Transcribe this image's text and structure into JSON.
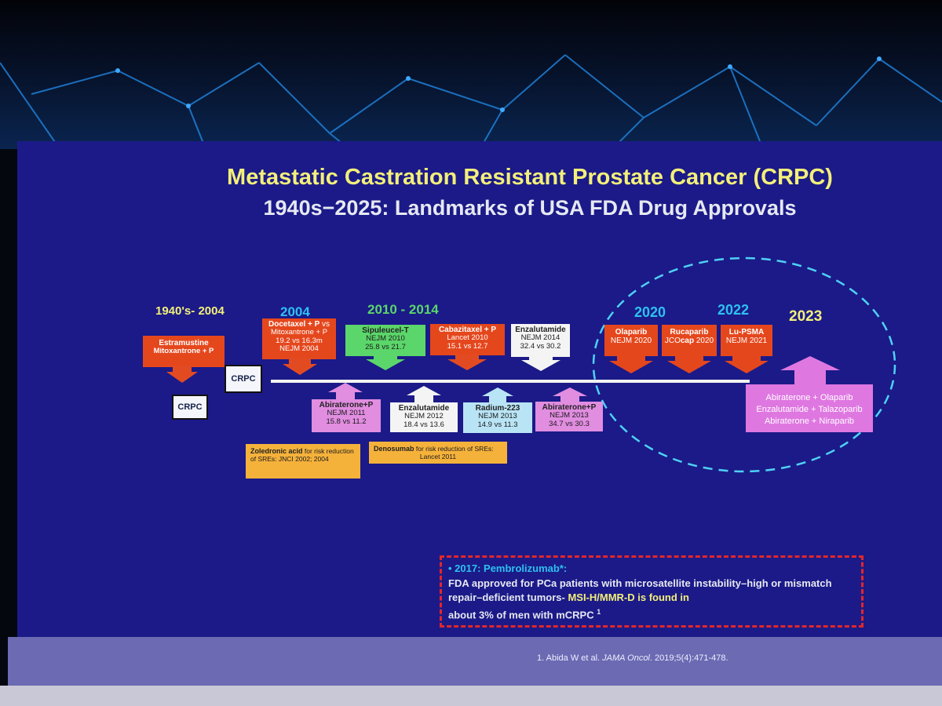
{
  "title_line1": "Metastatic Castration Resistant Prostate Cancer (CRPC)",
  "title_line2": "1940s−2025: Landmarks of USA FDA Drug Approvals",
  "eras": {
    "e1": "1940's- 2004",
    "e2": "2004",
    "e3": "2010 - 2014",
    "e4": "2020",
    "e5": "2022",
    "e6": "2023"
  },
  "crpc_label": "CRPC",
  "approvals_top": [
    {
      "name": "Estramustine",
      "line2": "Mitoxantrone + P"
    },
    {
      "name": "Docetaxel + P",
      "vs": "vs",
      "line2": "Mitoxantrone + P",
      "line3": "19.2 vs 16.3m",
      "line4": "NEJM 2004"
    },
    {
      "name": "Sipuleucel-T",
      "line2": "NEJM 2010",
      "line3": "25.8 vs 21.7"
    },
    {
      "name": "Cabazitaxel + P",
      "line2": "Lancet 2010",
      "line3": "15.1 vs 12.7"
    },
    {
      "name": "Enzalutamide",
      "line2": "NEJM 2014",
      "line3": "32.4 vs 30.2"
    },
    {
      "name": "Olaparib",
      "line2": "NEJM 2020"
    },
    {
      "name": "Rucaparib",
      "line2a": "JCO",
      "line2b": "cap",
      "line2c": " 2020"
    },
    {
      "name": "Lu-PSMA",
      "line2": "NEJM 2021"
    }
  ],
  "approvals_bottom": [
    {
      "name": "Abiraterone+P",
      "line2": "NEJM 2011",
      "line3": "15.8 vs 11.2"
    },
    {
      "name": "Enzalutamide",
      "line2": "NEJM 2012",
      "line3": "18.4 vs 13.6"
    },
    {
      "name": "Radium-223",
      "line2": "NEJM 2013",
      "line3": "14.9 vs 11.3"
    },
    {
      "name": "Abiraterone+P",
      "line2": "NEJM 2013",
      "line3": "34.7 vs 30.3"
    }
  ],
  "supportive": [
    {
      "drug": "Zoledronic acid",
      "text": " for risk reduction of SREs: JNCI 2002; 2004"
    },
    {
      "drug": "Denosumab",
      "text": " for risk reduction of SREs:",
      "line2": "Lancet 2011"
    }
  ],
  "combos_2023": [
    "Abiraterone + Olaparib",
    "Enzalutamide + Talazoparib",
    "Abiraterone + Niraparib"
  ],
  "pembro": {
    "head": "2017: Pembrolizumab*:",
    "body1": "FDA approved for PCa patients with microsatellite instability–high or mismatch repair–deficient tumors- ",
    "highlight": "MSI-H/MMR-D is found in",
    "body2": "about 3% of men with mCRPC",
    "sup": "1"
  },
  "reference": {
    "pre": "1. Abida W et al. ",
    "journal": "JAMA Oncol",
    "post": ". 2019;5(4):471-478."
  },
  "colors": {
    "title_yellow": "#f3ef7a",
    "slide_bg": "#1b1a88",
    "circle": "#4fd1f5",
    "red_box": "#e5471d",
    "green_box": "#5bd66a",
    "pink_box": "#e18de0",
    "note_border": "#e3262a"
  }
}
